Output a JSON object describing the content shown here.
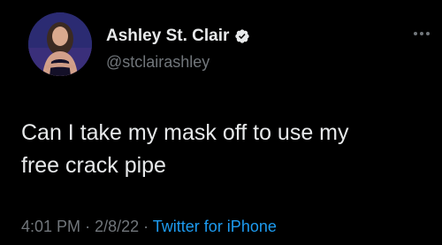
{
  "author": {
    "display_name": "Ashley St. Clair",
    "handle": "@stclairashley",
    "verified": true,
    "avatar_icon": "profile-photo",
    "verified_color": "#1d9bf0"
  },
  "tweet": {
    "lines": [
      "Can I take my mask off to use my",
      "free crack pipe"
    ]
  },
  "meta": {
    "time": "4:01 PM",
    "separator": "·",
    "date": "2/8/22",
    "source": "Twitter for iPhone"
  },
  "colors": {
    "background": "#000000",
    "text": "#e7e9ea",
    "muted": "#71767b",
    "link": "#1d9bf0"
  }
}
